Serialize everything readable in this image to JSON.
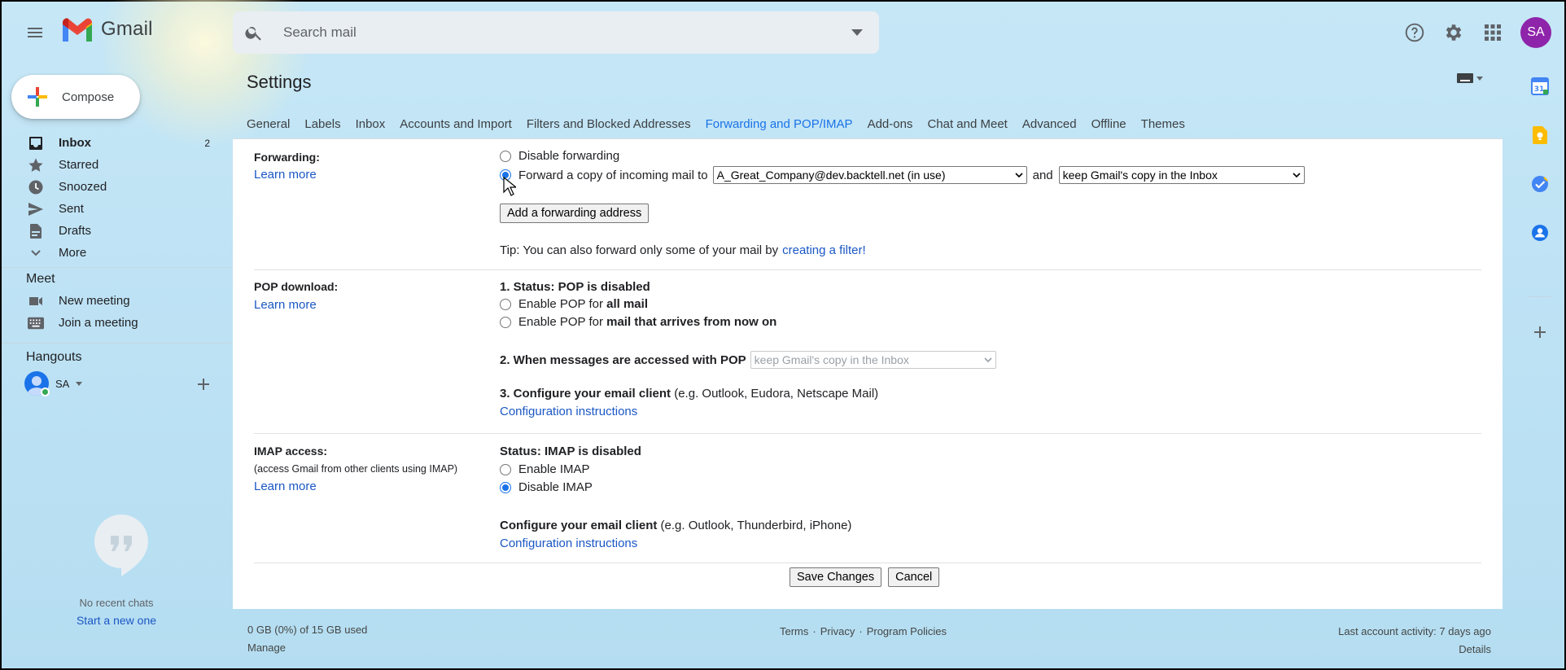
{
  "header": {
    "app_name": "Gmail",
    "search_placeholder": "Search mail",
    "avatar_initials": "SA"
  },
  "compose": {
    "label": "Compose"
  },
  "nav": {
    "items": [
      {
        "label": "Inbox",
        "count": "2",
        "icon": "inbox-icon",
        "active": true
      },
      {
        "label": "Starred",
        "icon": "star-icon"
      },
      {
        "label": "Snoozed",
        "icon": "clock-icon"
      },
      {
        "label": "Sent",
        "icon": "send-icon"
      },
      {
        "label": "Drafts",
        "icon": "draft-icon"
      },
      {
        "label": "More",
        "icon": "chevron-down-icon"
      }
    ],
    "meet_title": "Meet",
    "meet_items": [
      {
        "label": "New meeting",
        "icon": "video-icon"
      },
      {
        "label": "Join a meeting",
        "icon": "keyboard-icon"
      }
    ],
    "hangouts_title": "Hangouts",
    "hangouts_user": "SA",
    "no_chats": "No recent chats",
    "start_new": "Start a new one"
  },
  "settings": {
    "title": "Settings",
    "tabs": [
      "General",
      "Labels",
      "Inbox",
      "Accounts and Import",
      "Filters and Blocked Addresses",
      "Forwarding and POP/IMAP",
      "Add-ons",
      "Chat and Meet",
      "Advanced",
      "Offline",
      "Themes"
    ],
    "active_tab": "Forwarding and POP/IMAP",
    "forwarding": {
      "label": "Forwarding:",
      "learn_more": "Learn more",
      "disable": "Disable forwarding",
      "forward_copy": "Forward a copy of incoming mail to",
      "address": "A_Great_Company@dev.backtell.net (in use)",
      "and": "and",
      "copy_action": "keep Gmail's copy in the Inbox",
      "add_button": "Add a forwarding address",
      "tip_prefix": "Tip: You can also forward only some of your mail by",
      "tip_link": "creating a filter!"
    },
    "pop": {
      "label": "POP download:",
      "learn_more": "Learn more",
      "status": "1. Status: POP is disabled",
      "enable_all_prefix": "Enable POP for",
      "enable_all_bold": "all mail",
      "enable_now_prefix": "Enable POP for",
      "enable_now_bold": "mail that arrives from now on",
      "when_label": "2. When messages are accessed with POP",
      "when_value": "keep Gmail's copy in the Inbox",
      "configure_bold": "3. Configure your email client",
      "configure_rest": "(e.g. Outlook, Eudora, Netscape Mail)",
      "config_link": "Configuration instructions"
    },
    "imap": {
      "label": "IMAP access:",
      "sublabel": "(access Gmail from other clients using IMAP)",
      "learn_more": "Learn more",
      "status": "Status: IMAP is disabled",
      "enable": "Enable IMAP",
      "disable": "Disable IMAP",
      "configure_bold": "Configure your email client",
      "configure_rest": "(e.g. Outlook, Thunderbird, iPhone)",
      "config_link": "Configuration instructions"
    },
    "save": "Save Changes",
    "cancel": "Cancel"
  },
  "footer": {
    "storage": "0 GB (0%) of 15 GB used",
    "manage": "Manage",
    "terms": "Terms",
    "privacy": "Privacy",
    "policies": "Program Policies",
    "sep": "·",
    "activity": "Last account activity: 7 days ago",
    "details": "Details"
  },
  "side_panel": {
    "calendar_day": "31"
  },
  "colors": {
    "accent": "#1a73e8",
    "link": "#1a57c4",
    "avatar": "#8e24aa"
  }
}
